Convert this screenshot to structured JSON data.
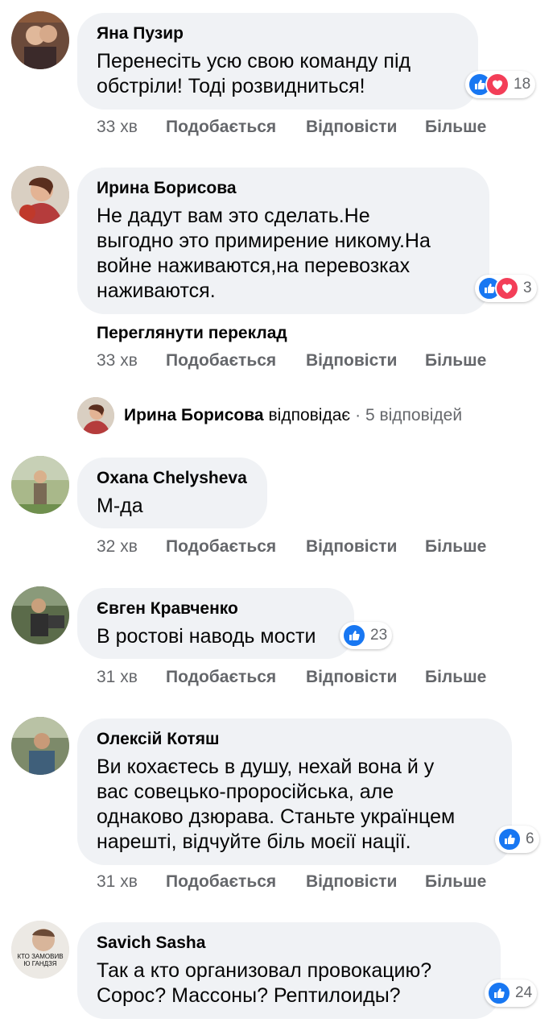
{
  "comments": [
    {
      "author": "Яна Пузир",
      "text": "Перенесіть усю свою команду під\nобстріли! Тоді розвидниться!",
      "reaction_count": "18",
      "time": "33 хв"
    },
    {
      "author": "Ирина Борисова",
      "text": "Не дадут вам это сделать.Не\nвыгодно это примирение никому.На\nвойне наживаются,на перевозках\nнаживаются.",
      "reaction_count": "3",
      "translate_label": "Переглянути переклад",
      "time": "33 хв",
      "replies": {
        "name": "Ирина Борисова",
        "verb": "відповідає",
        "count": "· 5 відповідей"
      }
    },
    {
      "author": "Oxana Chelysheva",
      "text": "М-да",
      "time": "32 хв"
    },
    {
      "author": "Євген Кравченко",
      "text": "В ростові наводь мости",
      "reaction_count": "23",
      "time": "31 хв"
    },
    {
      "author": "Олексій Котяш",
      "text": "Ви кохаєтесь в душу, нехай вона й у\nвас совецько-проросійська, але\nоднаково дзюрава. Станьте українцем\nнарешті, відчуйте біль моєії нації.",
      "reaction_count": "6",
      "time": "31 хв"
    },
    {
      "author": "Savich Sasha",
      "text": "Так а кто организовал провокацию?\nСорос? Массоны? Рептилоиды?",
      "reaction_count": "24",
      "avatar_text": "КТО ЗАМОВИВ\nЮ ГАНДЗЯ"
    }
  ],
  "actions": {
    "like": "Подобається",
    "reply": "Відповісти",
    "more": "Більше"
  },
  "colors": {
    "bubble": "#f0f2f5",
    "like": "#1877f2",
    "love": "#f33e58",
    "meta_text": "#65676b"
  },
  "icons": [
    "like-reaction-icon",
    "love-reaction-icon"
  ]
}
